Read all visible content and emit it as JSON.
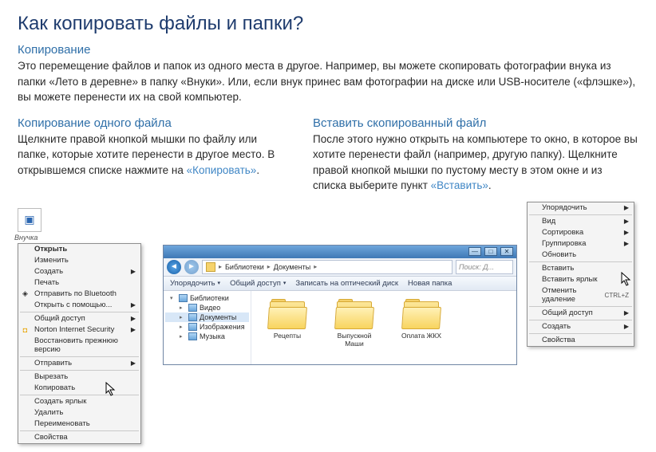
{
  "article": {
    "title": "Как копировать файлы и папки?",
    "section_intro": {
      "heading": "Копирование",
      "body": "Это перемещение файлов и папок из одного места в другое. Например, вы можете скопировать фотографии внука из папки «Лето в деревне» в папку «Внуки». Или, если внук принес вам фотографии на диске или USB-носителе («флэшке»), вы можете перенести их на свой компьютер."
    },
    "section_copy": {
      "heading": "Копирование одного файла",
      "body_pre": "Щелкните правой кнопкой мышки по файлу или папке, которые хотите перенести в другое место. В открывшемся списке нажмите на ",
      "link": "«Копировать»",
      "body_post": "."
    },
    "section_paste": {
      "heading": "Вставить скопированный файл",
      "body_pre": "После этого нужно открыть на компьютере то окно, в которое вы хотите перенести файл (например, другую папку). Щелкните правой кнопкой мышки по пустому месту в этом окне и из списка выберите пункт ",
      "link": "«Вставить»",
      "body_post": "."
    }
  },
  "fig1": {
    "file_label": "Внучка",
    "menu": [
      {
        "label": "Открыть",
        "bold": true
      },
      {
        "label": "Изменить"
      },
      {
        "label": "Создать",
        "sub": true
      },
      {
        "label": "Печать"
      },
      {
        "label": "Отправить по Bluetooth",
        "icon": "◈"
      },
      {
        "label": "Открыть с помощью...",
        "sub": true
      },
      {
        "sep": true
      },
      {
        "label": "Общий доступ",
        "sub": true
      },
      {
        "label": "Norton Internet Security",
        "sub": true,
        "icon": "◘",
        "iconcolor": "#e8a400"
      },
      {
        "label": "Восстановить прежнюю версию"
      },
      {
        "sep": true
      },
      {
        "label": "Отправить",
        "sub": true
      },
      {
        "sep": true
      },
      {
        "label": "Вырезать"
      },
      {
        "label": "Копировать"
      },
      {
        "sep": true
      },
      {
        "label": "Создать ярлык"
      },
      {
        "label": "Удалить"
      },
      {
        "label": "Переименовать"
      },
      {
        "sep": true
      },
      {
        "label": "Свойства"
      }
    ]
  },
  "fig2": {
    "crumbs": [
      "Библиотеки",
      "Документы"
    ],
    "search_placeholder": "Поиск: Д...",
    "toolbar": [
      "Упорядочить",
      "Общий доступ",
      "Записать на оптический диск",
      "Новая папка"
    ],
    "side": [
      {
        "label": "Библиотеки",
        "kind": "lib",
        "toggle": "▾"
      },
      {
        "label": "Видео",
        "kind": "lib",
        "toggle": "▸",
        "indent": 1
      },
      {
        "label": "Документы",
        "kind": "lib",
        "toggle": "▸",
        "indent": 1,
        "sel": true
      },
      {
        "label": "Изображения",
        "kind": "lib",
        "toggle": "▸",
        "indent": 1
      },
      {
        "label": "Музыка",
        "kind": "lib",
        "toggle": "▸",
        "indent": 1
      }
    ],
    "folders": [
      "Рецепты",
      "Выпускной Маши",
      "Оплата ЖКХ"
    ]
  },
  "fig3": {
    "menu": [
      {
        "label": "Упорядочить",
        "sub": true
      },
      {
        "sep": true
      },
      {
        "label": "Вид",
        "sub": true
      },
      {
        "label": "Сортировка",
        "sub": true
      },
      {
        "label": "Группировка",
        "sub": true
      },
      {
        "label": "Обновить"
      },
      {
        "sep": true
      },
      {
        "label": "Вставить"
      },
      {
        "label": "Вставить ярлык"
      },
      {
        "label": "Отменить удаление",
        "shortcut": "CTRL+Z"
      },
      {
        "sep": true
      },
      {
        "label": "Общий доступ",
        "sub": true
      },
      {
        "sep": true
      },
      {
        "label": "Создать",
        "sub": true
      },
      {
        "sep": true
      },
      {
        "label": "Свойства"
      }
    ]
  }
}
